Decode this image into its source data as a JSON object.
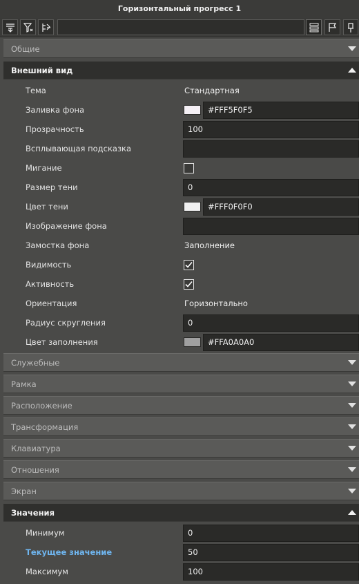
{
  "title": "Горизонтальный прогресс 1",
  "toolbar": {
    "search_value": "",
    "icons": [
      "sort-icon",
      "filter-icon",
      "tree-icon",
      "list-view-icon",
      "flag-icon",
      "pin-icon"
    ]
  },
  "sections": {
    "general": "Общие",
    "appearance": "Внешний вид",
    "service": "Служебные",
    "frame": "Рамка",
    "location": "Расположение",
    "transform": "Трансформация",
    "keyboard": "Клавиатура",
    "relations": "Отношения",
    "screen": "Экран",
    "values": "Значения"
  },
  "appearance": {
    "theme": {
      "label": "Тема",
      "value": "Стандартная"
    },
    "bg_fill": {
      "label": "Заливка фона",
      "value": "#FFF5F0F5",
      "swatch": "#f5f0f5"
    },
    "opacity": {
      "label": "Прозрачность",
      "value": "100"
    },
    "tooltip": {
      "label": "Всплывающая подсказка",
      "value": ""
    },
    "blink": {
      "label": "Мигание",
      "checked": false
    },
    "shadow_size": {
      "label": "Размер тени",
      "value": "0"
    },
    "shadow_color": {
      "label": "Цвет тени",
      "value": "#FFF0F0F0",
      "swatch": "#f0f0f0"
    },
    "bg_image": {
      "label": "Изображение фона",
      "value": ""
    },
    "bg_tiling": {
      "label": "Замостка фона",
      "value": "Заполнение"
    },
    "visibility": {
      "label": "Видимость",
      "checked": true
    },
    "activity": {
      "label": "Активность",
      "checked": true
    },
    "orientation": {
      "label": "Ориентация",
      "value": "Горизонтально"
    },
    "corner_radius": {
      "label": "Радиус скругления",
      "value": "0"
    },
    "fill_color": {
      "label": "Цвет заполнения",
      "value": "#FFA0A0A0",
      "swatch": "#a0a0a0"
    }
  },
  "values": {
    "minimum": {
      "label": "Минимум",
      "value": "0"
    },
    "current": {
      "label": "Текущее значение",
      "value": "50"
    },
    "maximum": {
      "label": "Максимум",
      "value": "100"
    }
  }
}
